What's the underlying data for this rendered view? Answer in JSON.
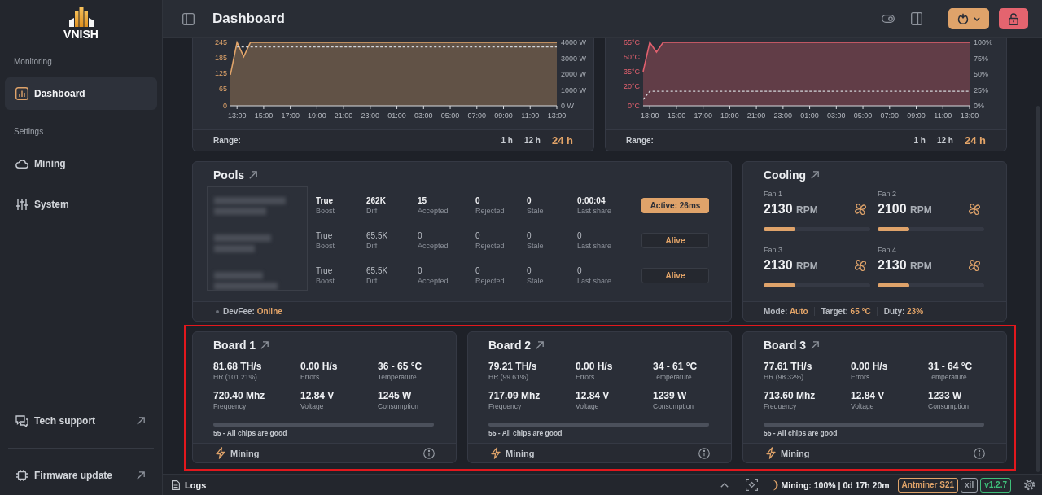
{
  "sidebar": {
    "logo_text": "VNISH",
    "sections": [
      {
        "label": "Monitoring",
        "items": [
          {
            "label": "Dashboard",
            "selected": true
          }
        ]
      },
      {
        "label": "Settings",
        "items": [
          {
            "label": "Mining",
            "selected": false
          },
          {
            "label": "System",
            "selected": false
          }
        ]
      }
    ],
    "footer_links": [
      {
        "label": "Tech support"
      },
      {
        "label": "Firmware update"
      }
    ]
  },
  "header": {
    "title": "Dashboard"
  },
  "charts": [
    {
      "chart_data": {
        "type": "area",
        "categories": [
          null,
          "13:00",
          null,
          null,
          null,
          "15:00",
          null,
          null,
          null,
          "17:00",
          null,
          null,
          null,
          "19:00",
          null,
          null,
          null,
          "21:00",
          null,
          null,
          null,
          "23:00",
          null,
          null,
          null,
          "01:00",
          null,
          null,
          null,
          "03:00",
          null,
          null,
          null,
          "05:00",
          null,
          null,
          null,
          "07:00",
          null,
          null,
          null,
          "09:00",
          null,
          null,
          null,
          "11:00",
          null,
          null,
          null,
          "13:00"
        ],
        "ylim": [
          0,
          245
        ],
        "yticks": [
          0,
          65,
          125,
          185,
          245
        ],
        "y2lim": [
          0,
          4000
        ],
        "y2ticks": [
          {
            "value": 0,
            "label": "0 W"
          },
          {
            "value": 1000,
            "label": "1000 W"
          },
          {
            "value": 2000,
            "label": "2000 W"
          },
          {
            "value": 3000,
            "label": "3000 W"
          },
          {
            "value": 4000,
            "label": "4000 W"
          }
        ],
        "series": [
          {
            "color": "#e0a46a",
            "values": [
              120,
              245,
              190,
              245,
              245,
              245,
              245,
              245,
              245,
              245,
              245,
              245,
              245,
              245,
              245,
              245,
              245,
              245,
              245,
              245,
              245,
              245,
              245,
              245,
              245,
              245,
              245,
              245,
              245,
              245,
              245,
              245,
              245,
              245,
              245,
              245,
              245,
              245,
              245,
              245,
              245,
              245,
              245,
              245,
              245,
              245,
              245,
              245,
              245,
              245
            ]
          },
          {
            "type": "line",
            "line_style": "dashed",
            "color": "#d4d7dc",
            "axis": "y2",
            "values": [
              null,
              3720,
              3720,
              3720,
              3720,
              3720,
              3720,
              3720,
              3720,
              3720,
              3720,
              3720,
              3720,
              3720,
              3720,
              3720,
              3720,
              3720,
              3720,
              3720,
              3720,
              3720,
              3720,
              3720,
              3720,
              3720,
              3720,
              3720,
              3720,
              3720,
              3720,
              3720,
              3720,
              3720,
              3720,
              3720,
              3720,
              3720,
              3720,
              3720,
              3720,
              3720,
              3720,
              3720,
              3720,
              3720,
              3720,
              3720,
              3720,
              3720
            ]
          }
        ]
      },
      "range_label": "Range:",
      "ranges": [
        {
          "label": "1 h",
          "selected": false
        },
        {
          "label": "12 h",
          "selected": false
        },
        {
          "label": "24 h",
          "selected": true
        }
      ]
    },
    {
      "chart_data": {
        "type": "area",
        "categories": [
          null,
          "13:00",
          null,
          null,
          null,
          "15:00",
          null,
          null,
          null,
          "17:00",
          null,
          null,
          null,
          "19:00",
          null,
          null,
          null,
          "21:00",
          null,
          null,
          null,
          "23:00",
          null,
          null,
          null,
          "01:00",
          null,
          null,
          null,
          "03:00",
          null,
          null,
          null,
          "05:00",
          null,
          null,
          null,
          "07:00",
          null,
          null,
          null,
          "09:00",
          null,
          null,
          null,
          "11:00",
          null,
          null,
          null,
          "13:00"
        ],
        "ylim": [
          0,
          65
        ],
        "yticks": [
          {
            "value": 0,
            "label": "0°C"
          },
          {
            "value": 20,
            "label": "20°C"
          },
          {
            "value": 35,
            "label": "35°C"
          },
          {
            "value": 50,
            "label": "50°C"
          },
          {
            "value": 65,
            "label": "65°C"
          }
        ],
        "y2lim": [
          0,
          100
        ],
        "y2ticks": [
          {
            "value": 0,
            "label": "0%"
          },
          {
            "value": 25,
            "label": "25%"
          },
          {
            "value": 50,
            "label": "50%"
          },
          {
            "value": 75,
            "label": "75%"
          },
          {
            "value": 100,
            "label": "100%"
          }
        ],
        "series": [
          {
            "color": "#e0606e",
            "values": [
              35,
              65,
              55,
              65,
              65,
              65,
              65,
              65,
              65,
              65,
              65,
              65,
              65,
              65,
              65,
              65,
              65,
              65,
              65,
              65,
              65,
              65,
              65,
              65,
              65,
              65,
              65,
              65,
              65,
              65,
              65,
              65,
              65,
              65,
              65,
              65,
              65,
              65,
              65,
              65,
              65,
              65,
              65,
              65,
              65,
              65,
              65,
              65,
              65,
              65
            ]
          },
          {
            "type": "line",
            "line_style": "dashed",
            "color": "#d4d7dc",
            "axis": "y2",
            "values": [
              10,
              23,
              23,
              23,
              23,
              23,
              23,
              23,
              23,
              23,
              23,
              23,
              23,
              23,
              23,
              23,
              23,
              23,
              23,
              23,
              23,
              23,
              23,
              23,
              23,
              23,
              23,
              23,
              23,
              23,
              23,
              23,
              23,
              23,
              23,
              23,
              23,
              23,
              23,
              23,
              23,
              23,
              23,
              23,
              23,
              23,
              23,
              23,
              23,
              23
            ]
          }
        ]
      },
      "range_label": "Range:",
      "ranges": [
        {
          "label": "1 h",
          "selected": false
        },
        {
          "label": "12 h",
          "selected": false
        },
        {
          "label": "24 h",
          "selected": true
        }
      ]
    }
  ],
  "pools": {
    "title": "Pools",
    "rows": [
      {
        "active": true,
        "cells": [
          {
            "value": "True",
            "label": "Boost"
          },
          {
            "value": "262K",
            "label": "Diff"
          },
          {
            "value": "15",
            "label": "Accepted"
          },
          {
            "value": "0",
            "label": "Rejected"
          },
          {
            "value": "0",
            "label": "Stale"
          },
          {
            "value": "0:00:04",
            "label": "Last share"
          }
        ],
        "status": "Active: 26ms"
      },
      {
        "active": false,
        "cells": [
          {
            "value": "True",
            "label": "Boost"
          },
          {
            "value": "65.5K",
            "label": "Diff"
          },
          {
            "value": "0",
            "label": "Accepted"
          },
          {
            "value": "0",
            "label": "Rejected"
          },
          {
            "value": "0",
            "label": "Stale"
          },
          {
            "value": "0",
            "label": "Last share"
          }
        ],
        "status": "Alive"
      },
      {
        "active": false,
        "cells": [
          {
            "value": "True",
            "label": "Boost"
          },
          {
            "value": "65.5K",
            "label": "Diff"
          },
          {
            "value": "0",
            "label": "Accepted"
          },
          {
            "value": "0",
            "label": "Rejected"
          },
          {
            "value": "0",
            "label": "Stale"
          },
          {
            "value": "0",
            "label": "Last share"
          }
        ],
        "status": "Alive"
      }
    ],
    "devfee": {
      "label": "DevFee:",
      "value": "Online"
    }
  },
  "cooling": {
    "title": "Cooling",
    "fans": [
      {
        "label": "Fan 1",
        "rpm": "2130",
        "unit": "RPM",
        "level": 0.3
      },
      {
        "label": "Fan 2",
        "rpm": "2100",
        "unit": "RPM",
        "level": 0.3
      },
      {
        "label": "Fan 3",
        "rpm": "2130",
        "unit": "RPM",
        "level": 0.3
      },
      {
        "label": "Fan 4",
        "rpm": "2130",
        "unit": "RPM",
        "level": 0.3
      }
    ],
    "footer": [
      {
        "label": "Mode:",
        "value": "Auto"
      },
      {
        "label": "Target:",
        "value": "65 °C"
      },
      {
        "label": "Duty:",
        "value": "23%"
      }
    ]
  },
  "boards_highlighted": true,
  "boards": [
    {
      "title": "Board 1",
      "stats": [
        {
          "value": "81.68 TH/s",
          "label": "HR (101.21%)"
        },
        {
          "value": "0.00 H/s",
          "label": "Errors"
        },
        {
          "value": "36 - 65 °C",
          "label": "Temperature"
        },
        {
          "value": "720.40 Mhz",
          "label": "Frequency"
        },
        {
          "value": "12.84 V",
          "label": "Voltage"
        },
        {
          "value": "1245 W",
          "label": "Consumption"
        }
      ],
      "chips": "55 - All chips are good",
      "status": "Mining"
    },
    {
      "title": "Board 2",
      "stats": [
        {
          "value": "79.21 TH/s",
          "label": "HR (99.61%)"
        },
        {
          "value": "0.00 H/s",
          "label": "Errors"
        },
        {
          "value": "34 - 61 °C",
          "label": "Temperature"
        },
        {
          "value": "717.09 Mhz",
          "label": "Frequency"
        },
        {
          "value": "12.84 V",
          "label": "Voltage"
        },
        {
          "value": "1239 W",
          "label": "Consumption"
        }
      ],
      "chips": "55 - All chips are good",
      "status": "Mining"
    },
    {
      "title": "Board 3",
      "stats": [
        {
          "value": "77.61 TH/s",
          "label": "HR (98.32%)"
        },
        {
          "value": "0.00 H/s",
          "label": "Errors"
        },
        {
          "value": "31 - 64 °C",
          "label": "Temperature"
        },
        {
          "value": "713.60 Mhz",
          "label": "Frequency"
        },
        {
          "value": "12.84 V",
          "label": "Voltage"
        },
        {
          "value": "1233 W",
          "label": "Consumption"
        }
      ],
      "chips": "55 - All chips are good",
      "status": "Mining"
    }
  ],
  "status_bar": {
    "logs": "Logs",
    "mining": "Mining: 100% | 0d 17h 20m",
    "badges": [
      {
        "text": "Antminer S21",
        "color": "#e0a46a"
      },
      {
        "text": "xil",
        "color": "#9ea3ab"
      },
      {
        "text": "v1.2.7",
        "color": "#3fbf7a"
      }
    ]
  }
}
